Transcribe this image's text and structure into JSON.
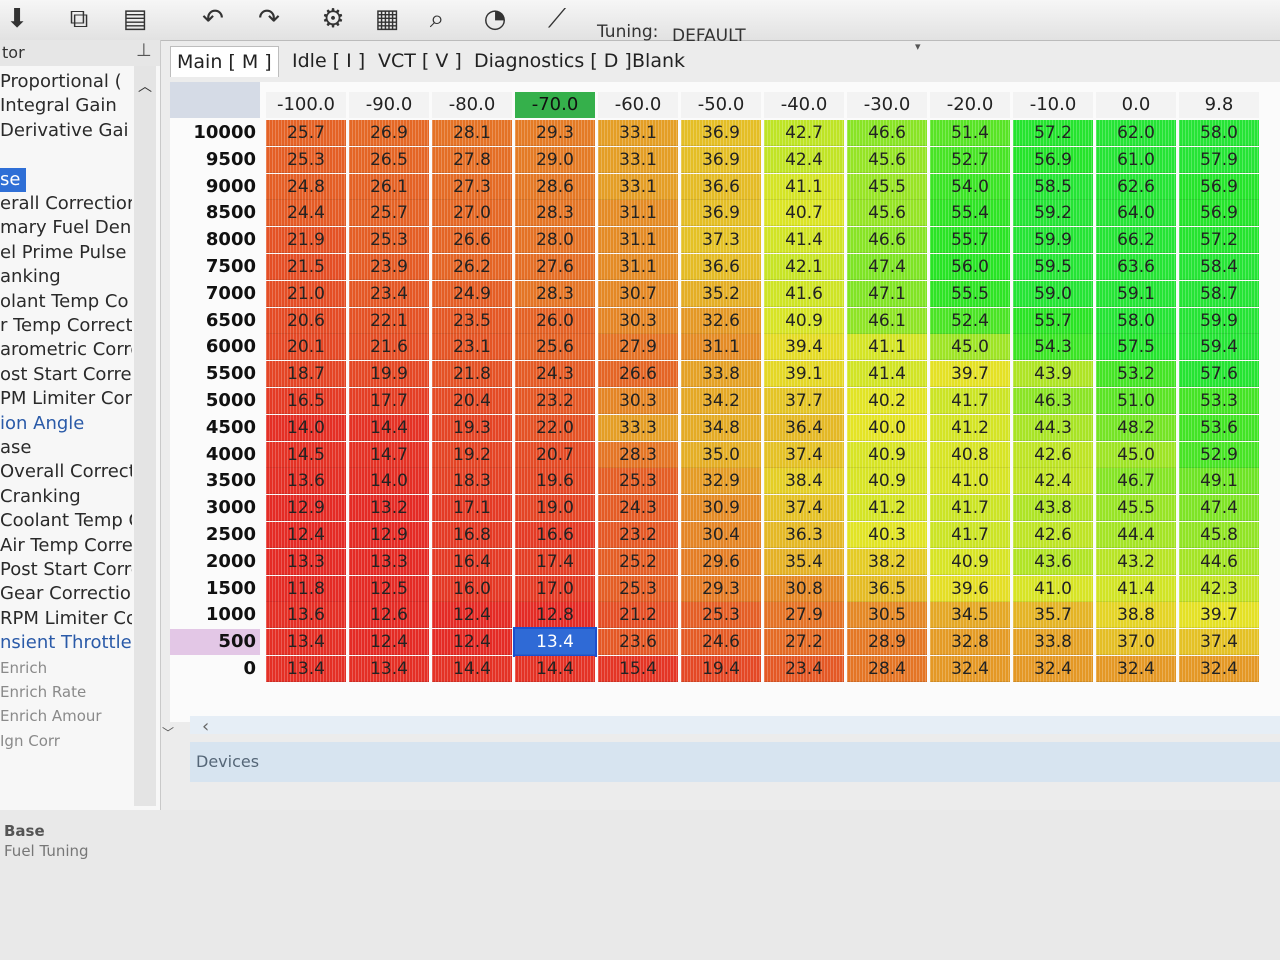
{
  "toolbar": {
    "buttons": [
      {
        "name": "download-icon",
        "glyph": "⬇"
      },
      {
        "name": "copy-icon",
        "glyph": "⧉"
      },
      {
        "name": "document-icon",
        "glyph": "▤"
      },
      {
        "name": "undo-icon",
        "glyph": "↶"
      },
      {
        "name": "redo-icon",
        "glyph": "↷"
      },
      {
        "name": "gear-icon",
        "glyph": "⚙"
      },
      {
        "name": "grid-icon",
        "glyph": "▦"
      },
      {
        "name": "search-icon",
        "glyph": "⌕"
      },
      {
        "name": "gauge-icon",
        "glyph": "◔"
      },
      {
        "name": "ruler-icon",
        "glyph": "⟋"
      }
    ],
    "tuning_label": "Tuning:",
    "tuning_value": "DEFAULT"
  },
  "navigator": {
    "title": "tor",
    "items": [
      {
        "label": "Proportional (",
        "style": "normal"
      },
      {
        "label": "Integral Gain",
        "style": "normal"
      },
      {
        "label": "Derivative Gai",
        "style": "normal"
      },
      {
        "label": "",
        "style": "spacer"
      },
      {
        "label": "se",
        "style": "selected"
      },
      {
        "label": "erall Correctior",
        "style": "normal"
      },
      {
        "label": "mary Fuel Den:",
        "style": "normal"
      },
      {
        "label": "el Prime Pulse",
        "style": "normal"
      },
      {
        "label": "anking",
        "style": "normal"
      },
      {
        "label": "olant Temp Co",
        "style": "normal"
      },
      {
        "label": "r Temp Correcti",
        "style": "normal"
      },
      {
        "label": "arometric Corre",
        "style": "normal"
      },
      {
        "label": "ost Start Correct",
        "style": "normal"
      },
      {
        "label": "PM Limiter Corr",
        "style": "normal"
      },
      {
        "label": "ion Angle",
        "style": "link"
      },
      {
        "label": "ase",
        "style": "normal"
      },
      {
        "label": "Overall Correctior",
        "style": "normal"
      },
      {
        "label": "Cranking",
        "style": "normal"
      },
      {
        "label": "Coolant Temp Co",
        "style": "normal"
      },
      {
        "label": "Air Temp Correcti",
        "style": "normal"
      },
      {
        "label": "Post Start Correct",
        "style": "normal"
      },
      {
        "label": "Gear Correction",
        "style": "normal"
      },
      {
        "label": "RPM Limiter Corr",
        "style": "normal"
      },
      {
        "label": "nsient Throttle",
        "style": "link"
      },
      {
        "label": "Enrich",
        "style": "faded"
      },
      {
        "label": "Enrich Rate",
        "style": "faded"
      },
      {
        "label": "Enrich Amour",
        "style": "faded"
      },
      {
        "label": "Ign Corr",
        "style": "faded"
      }
    ],
    "footer_title": "Base",
    "footer_sub": "Fuel Tuning"
  },
  "tabs": [
    {
      "label": "Main [ M ]",
      "active": true
    },
    {
      "label": "Idle [ I ]",
      "active": false
    },
    {
      "label": "VCT [ V ]",
      "active": false
    },
    {
      "label": "Diagnostics [ D ]",
      "active": false
    },
    {
      "label": "Blank",
      "active": false
    }
  ],
  "table": {
    "columns": [
      "-100.0",
      "-90.0",
      "-80.0",
      "-70.0",
      "-60.0",
      "-50.0",
      "-40.0",
      "-30.0",
      "-20.0",
      "-10.0",
      "0.0",
      "9.8"
    ],
    "active_column": 3,
    "active_row": 19,
    "selected_cell": {
      "row": 19,
      "col": 3
    },
    "rows": [
      {
        "label": "10000",
        "values": [
          "25.7",
          "26.9",
          "28.1",
          "29.3",
          "33.1",
          "36.9",
          "42.7",
          "46.6",
          "51.4",
          "57.2",
          "62.0",
          "58.0"
        ]
      },
      {
        "label": "9500",
        "values": [
          "25.3",
          "26.5",
          "27.8",
          "29.0",
          "33.1",
          "36.9",
          "42.4",
          "45.6",
          "52.7",
          "56.9",
          "61.0",
          "57.9"
        ]
      },
      {
        "label": "9000",
        "values": [
          "24.8",
          "26.1",
          "27.3",
          "28.6",
          "33.1",
          "36.6",
          "41.1",
          "45.5",
          "54.0",
          "58.5",
          "62.6",
          "56.9"
        ]
      },
      {
        "label": "8500",
        "values": [
          "24.4",
          "25.7",
          "27.0",
          "28.3",
          "31.1",
          "36.9",
          "40.7",
          "45.6",
          "55.4",
          "59.2",
          "64.0",
          "56.9"
        ]
      },
      {
        "label": "8000",
        "values": [
          "21.9",
          "25.3",
          "26.6",
          "28.0",
          "31.1",
          "37.3",
          "41.4",
          "46.6",
          "55.7",
          "59.9",
          "66.2",
          "57.2"
        ]
      },
      {
        "label": "7500",
        "values": [
          "21.5",
          "23.9",
          "26.2",
          "27.6",
          "31.1",
          "36.6",
          "42.1",
          "47.4",
          "56.0",
          "59.5",
          "63.6",
          "58.4"
        ]
      },
      {
        "label": "7000",
        "values": [
          "21.0",
          "23.4",
          "24.9",
          "28.3",
          "30.7",
          "35.2",
          "41.6",
          "47.1",
          "55.5",
          "59.0",
          "59.1",
          "58.7"
        ]
      },
      {
        "label": "6500",
        "values": [
          "20.6",
          "22.1",
          "23.5",
          "26.0",
          "30.3",
          "32.6",
          "40.9",
          "46.1",
          "52.4",
          "55.7",
          "58.0",
          "59.9"
        ]
      },
      {
        "label": "6000",
        "values": [
          "20.1",
          "21.6",
          "23.1",
          "25.6",
          "27.9",
          "31.1",
          "39.4",
          "41.1",
          "45.0",
          "54.3",
          "57.5",
          "59.4"
        ]
      },
      {
        "label": "5500",
        "values": [
          "18.7",
          "19.9",
          "21.8",
          "24.3",
          "26.6",
          "33.8",
          "39.1",
          "41.4",
          "39.7",
          "43.9",
          "53.2",
          "57.6"
        ]
      },
      {
        "label": "5000",
        "values": [
          "16.5",
          "17.7",
          "20.4",
          "23.2",
          "30.3",
          "34.2",
          "37.7",
          "40.2",
          "41.7",
          "46.3",
          "51.0",
          "53.3"
        ]
      },
      {
        "label": "4500",
        "values": [
          "14.0",
          "14.4",
          "19.3",
          "22.0",
          "33.3",
          "34.8",
          "36.4",
          "40.0",
          "41.2",
          "44.3",
          "48.2",
          "53.6"
        ]
      },
      {
        "label": "4000",
        "values": [
          "14.5",
          "14.7",
          "19.2",
          "20.7",
          "28.3",
          "35.0",
          "37.4",
          "40.9",
          "40.8",
          "42.6",
          "45.0",
          "52.9"
        ]
      },
      {
        "label": "3500",
        "values": [
          "13.6",
          "14.0",
          "18.3",
          "19.6",
          "25.3",
          "32.9",
          "38.4",
          "40.9",
          "41.0",
          "42.4",
          "46.7",
          "49.1"
        ]
      },
      {
        "label": "3000",
        "values": [
          "12.9",
          "13.2",
          "17.1",
          "19.0",
          "24.3",
          "30.9",
          "37.4",
          "41.2",
          "41.7",
          "43.8",
          "45.5",
          "47.4"
        ]
      },
      {
        "label": "2500",
        "values": [
          "12.4",
          "12.9",
          "16.8",
          "16.6",
          "23.2",
          "30.4",
          "36.3",
          "40.3",
          "41.7",
          "42.6",
          "44.4",
          "45.8"
        ]
      },
      {
        "label": "2000",
        "values": [
          "13.3",
          "13.3",
          "16.4",
          "17.4",
          "25.2",
          "29.6",
          "35.4",
          "38.2",
          "40.9",
          "43.6",
          "43.2",
          "44.6"
        ]
      },
      {
        "label": "1500",
        "values": [
          "11.8",
          "12.5",
          "16.0",
          "17.0",
          "25.3",
          "29.3",
          "30.8",
          "36.5",
          "39.6",
          "41.0",
          "41.4",
          "42.3"
        ]
      },
      {
        "label": "1000",
        "values": [
          "13.6",
          "12.6",
          "12.4",
          "12.8",
          "21.2",
          "25.3",
          "27.9",
          "30.5",
          "34.5",
          "35.7",
          "38.8",
          "39.7"
        ]
      },
      {
        "label": "500",
        "values": [
          "13.4",
          "12.4",
          "12.4",
          "13.4",
          "23.6",
          "24.6",
          "27.2",
          "28.9",
          "32.8",
          "33.8",
          "37.0",
          "37.4"
        ]
      },
      {
        "label": "0",
        "values": [
          "13.4",
          "13.4",
          "14.4",
          "14.4",
          "15.4",
          "19.4",
          "23.4",
          "28.4",
          "32.4",
          "32.4",
          "32.4",
          "32.4"
        ]
      }
    ]
  },
  "status": {
    "devices_label": "Devices"
  }
}
